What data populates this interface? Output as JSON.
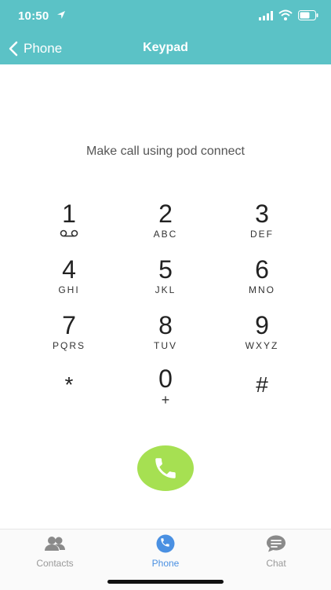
{
  "status": {
    "time": "10:50"
  },
  "header": {
    "back_label": "Phone",
    "title": "Keypad"
  },
  "prompt": "Make call using pod connect",
  "keypad": [
    {
      "digit": "1",
      "letters": ""
    },
    {
      "digit": "2",
      "letters": "ABC"
    },
    {
      "digit": "3",
      "letters": "DEF"
    },
    {
      "digit": "4",
      "letters": "GHI"
    },
    {
      "digit": "5",
      "letters": "JKL"
    },
    {
      "digit": "6",
      "letters": "MNO"
    },
    {
      "digit": "7",
      "letters": "PQRS"
    },
    {
      "digit": "8",
      "letters": "TUV"
    },
    {
      "digit": "9",
      "letters": "WXYZ"
    },
    {
      "digit": "*",
      "letters": ""
    },
    {
      "digit": "0",
      "letters": "+"
    },
    {
      "digit": "#",
      "letters": ""
    }
  ],
  "tabs": [
    {
      "label": "Contacts",
      "icon": "contacts-icon",
      "active": false
    },
    {
      "label": "Phone",
      "icon": "phone-icon",
      "active": true
    },
    {
      "label": "Chat",
      "icon": "chat-icon",
      "active": false
    }
  ],
  "colors": {
    "header": "#5bc2c6",
    "call": "#a6e052",
    "active_tab": "#4a90e2"
  }
}
